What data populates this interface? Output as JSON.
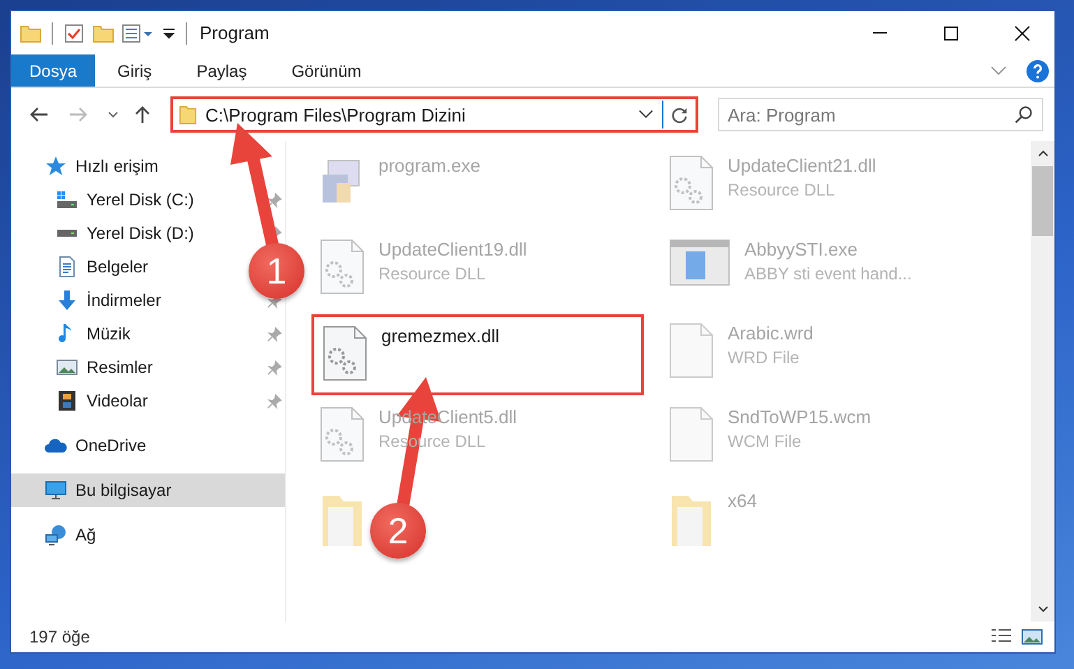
{
  "window": {
    "title": "Program"
  },
  "ribbon_tabs": [
    {
      "label": "Dosya",
      "selected": true
    },
    {
      "label": "Giriş",
      "selected": false
    },
    {
      "label": "Paylaş",
      "selected": false
    },
    {
      "label": "Görünüm",
      "selected": false
    }
  ],
  "address": {
    "path": "C:\\Program Files\\Program Dizini",
    "highlighted": true
  },
  "search": {
    "placeholder": "Ara: Program"
  },
  "sidebar": {
    "items": [
      {
        "label": "Hızlı erişim",
        "kind": "star",
        "selected": false,
        "children": [
          {
            "label": "Yerel Disk (C:)",
            "kind": "drive-windows",
            "pinned": true,
            "selected": false
          },
          {
            "label": "Yerel Disk (D:)",
            "kind": "drive",
            "pinned": true,
            "selected": false
          },
          {
            "label": "Belgeler",
            "kind": "documents",
            "selected": false
          },
          {
            "label": "İndirmeler",
            "kind": "download",
            "pinned": true,
            "selected": false
          },
          {
            "label": "Müzik",
            "kind": "music",
            "pinned": true,
            "selected": false
          },
          {
            "label": "Resimler",
            "kind": "pictures",
            "pinned": true,
            "selected": false
          },
          {
            "label": "Videolar",
            "kind": "videos",
            "pinned": true,
            "selected": false
          }
        ]
      },
      {
        "label": "OneDrive",
        "kind": "cloud",
        "selected": false
      },
      {
        "label": "Bu bilgisayar",
        "kind": "computer",
        "selected": true
      },
      {
        "label": "Ağ",
        "kind": "network",
        "selected": false
      }
    ]
  },
  "files": [
    {
      "name": "program.exe",
      "kind": "app",
      "blurred": true,
      "highlighted": false
    },
    {
      "name": "UpdateClient21.dll",
      "type": "Resource DLL",
      "kind": "dll",
      "blurred": true,
      "highlighted": false
    },
    {
      "name": "UpdateClient19.dll",
      "type": "Resource DLL",
      "kind": "dll",
      "blurred": true,
      "highlighted": false
    },
    {
      "name": "AbbyySTI.exe",
      "type": "ABBY sti event hand...",
      "kind": "window",
      "blurred": true,
      "highlighted": false
    },
    {
      "name": "gremezmex.dll",
      "kind": "dll",
      "blurred": false,
      "highlighted": true
    },
    {
      "name": "Arabic.wrd",
      "type": "WRD File",
      "kind": "file",
      "blurred": true,
      "highlighted": false
    },
    {
      "name": "UpdateClient5.dll",
      "type": "Resource DLL",
      "kind": "dll",
      "blurred": true,
      "highlighted": false
    },
    {
      "name": "SndToWP15.wcm",
      "type": "WCM File",
      "kind": "file",
      "blurred": true,
      "highlighted": false
    },
    {
      "kind": "folder",
      "blurred": true,
      "highlighted": false
    },
    {
      "name": "x64",
      "kind": "folder",
      "blurred": true,
      "highlighted": false
    }
  ],
  "status_bar": {
    "count": "197 öğe"
  },
  "annotations": [
    {
      "number": "1"
    },
    {
      "number": "2"
    }
  ]
}
